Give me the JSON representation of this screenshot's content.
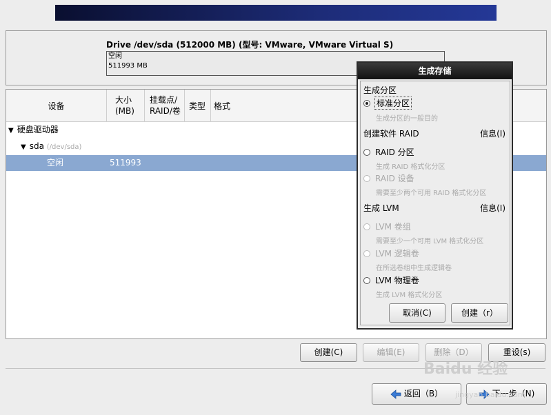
{
  "drive": {
    "title": "Drive /dev/sda (512000 MB) (型号: VMware, VMware Virtual S)",
    "bar_label": "空闲",
    "bar_size": "511993 MB"
  },
  "table": {
    "headers": [
      "设备",
      "大小\n(MB)",
      "挂载点/\nRAID/卷",
      "类型",
      "格式"
    ],
    "rows": [
      {
        "device": "硬盘驱动器",
        "size": "",
        "sub": ""
      },
      {
        "device": "sda",
        "size": "",
        "sub": "(/dev/sda)"
      },
      {
        "device": "空闲",
        "size": "511993",
        "sub": ""
      }
    ]
  },
  "buttons": {
    "create": "创建(C)",
    "edit": "编辑(E)",
    "delete": "删除（D）",
    "reset": "重设(s)",
    "back": "返回（B）",
    "next": "下一步（N)"
  },
  "dialog": {
    "title": "生成存储",
    "section_partition": "生成分区",
    "opt_standard": "标准分区",
    "desc_standard": "生成分区的一般目的",
    "section_raid": "创建软件 RAID",
    "info_raid": "信息(I)",
    "opt_raid_partition": "RAID 分区",
    "desc_raid_partition": "生成 RAID 格式化分区",
    "opt_raid_device": "RAID 设备",
    "desc_raid_device": "需要至少两个可用 RAID 格式化分区",
    "section_lvm": "生成 LVM",
    "info_lvm": "信息(I)",
    "opt_lvm_vg": "LVM 卷组",
    "desc_lvm_vg": "需要至少一个可用 LVM 格式化分区",
    "opt_lvm_lv": "LVM 逻辑卷",
    "desc_lvm_lv": "在所选卷组中生成逻辑卷",
    "opt_lvm_pv": "LVM 物理卷",
    "desc_lvm_pv": "生成 LVM 格式化分区",
    "cancel": "取消(C)",
    "create": "创建（r）"
  },
  "watermark": {
    "logo": "Baidu 经验",
    "url": "jingyan.baidu.com"
  },
  "colors": {
    "selection": "#8aa8d1",
    "dialog_title_bg": "#111111",
    "banner": "#1d2c78"
  }
}
